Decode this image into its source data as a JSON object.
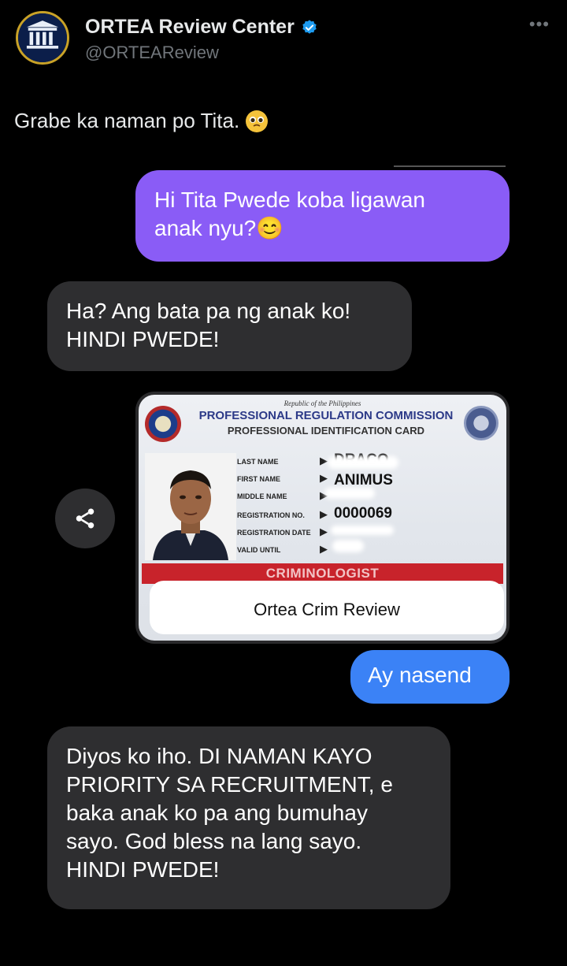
{
  "account": {
    "display_name": "ORTEA Review Center",
    "handle": "@ORTEAReview",
    "verified_icon": "verified-badge-icon",
    "more_icon": "more-options-icon"
  },
  "tweet": {
    "text": "Grabe ka naman po Tita.",
    "emoji": "pleading-face-emoji"
  },
  "chat": {
    "msg1": [
      "Hi Tita Pwede koba ligawan",
      "anak nyu?😊"
    ],
    "msg2": [
      "Ha? Ang bata pa ng anak ko!",
      "HINDI PWEDE!"
    ],
    "msg3": "Ay nasend",
    "msg4": [
      "Diyos ko iho. DI NAMAN KAYO",
      "PRIORITY SA RECRUITMENT, e",
      "baka anak ko pa ang bumuhay",
      "sayo. God bless na lang sayo.",
      "HINDI PWEDE!"
    ]
  },
  "id_card": {
    "republic": "Republic of the Philippines",
    "title": "PROFESSIONAL REGULATION COMMISSION",
    "subtitle": "PROFESSIONAL IDENTIFICATION CARD",
    "labels": {
      "last_name": "LAST NAME",
      "first_name": "FIRST NAME",
      "middle_name": "MIDDLE NAME",
      "registration_no": "REGISTRATION NO.",
      "registration_date": "REGISTRATION DATE",
      "valid_until": "VALID UNTIL"
    },
    "values": {
      "last_name": "DRACO",
      "first_name": "ANIMUS",
      "registration_no": "0000069"
    },
    "profession": "CRIMINOLOGIST",
    "watermark": "Ortea Crim Review"
  },
  "colors": {
    "sent_purple": "#8a5cf6",
    "sent_blue": "#3b82f6",
    "received_gray": "#2e2e30",
    "background": "#000000"
  }
}
